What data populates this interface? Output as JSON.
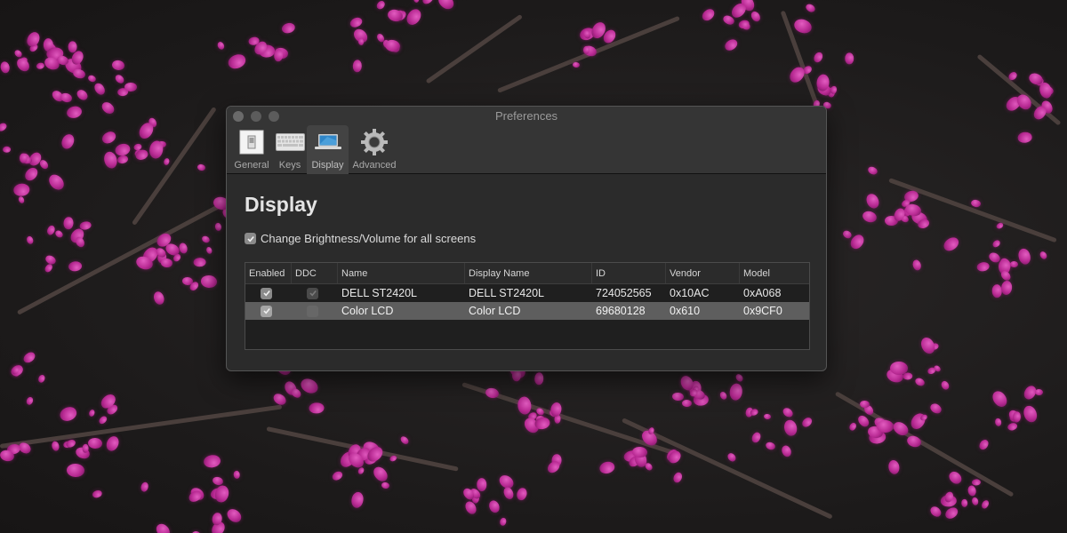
{
  "window": {
    "title": "Preferences",
    "traffic_lights": [
      "close",
      "minimize",
      "zoom"
    ]
  },
  "toolbar": {
    "items": [
      {
        "label": "General",
        "icon": "general-switch-icon",
        "selected": false
      },
      {
        "label": "Keys",
        "icon": "keyboard-icon",
        "selected": false
      },
      {
        "label": "Display",
        "icon": "laptop-icon",
        "selected": true
      },
      {
        "label": "Advanced",
        "icon": "gear-icon",
        "selected": false
      }
    ]
  },
  "content": {
    "heading": "Display",
    "all_screens_checkbox": {
      "label": "Change Brightness/Volume for all screens",
      "checked": true
    }
  },
  "table": {
    "columns": [
      "Enabled",
      "DDC",
      "Name",
      "Display Name",
      "ID",
      "Vendor",
      "Model"
    ],
    "rows": [
      {
        "enabled": true,
        "ddc": true,
        "ddc_disabled": true,
        "name": "DELL ST2420L",
        "display_name": "DELL ST2420L",
        "id": "724052565",
        "vendor": "0x10AC",
        "model": "0xA068",
        "selected": false
      },
      {
        "enabled": true,
        "ddc": false,
        "ddc_disabled": true,
        "name": "Color LCD",
        "display_name": "Color LCD",
        "id": "69680128",
        "vendor": "0x610",
        "model": "0x9CF0",
        "selected": true
      }
    ]
  },
  "colors": {
    "window_bg": "#2b2b2b",
    "selected_row": "#5e5e5e",
    "blossom": "#c0309a"
  }
}
